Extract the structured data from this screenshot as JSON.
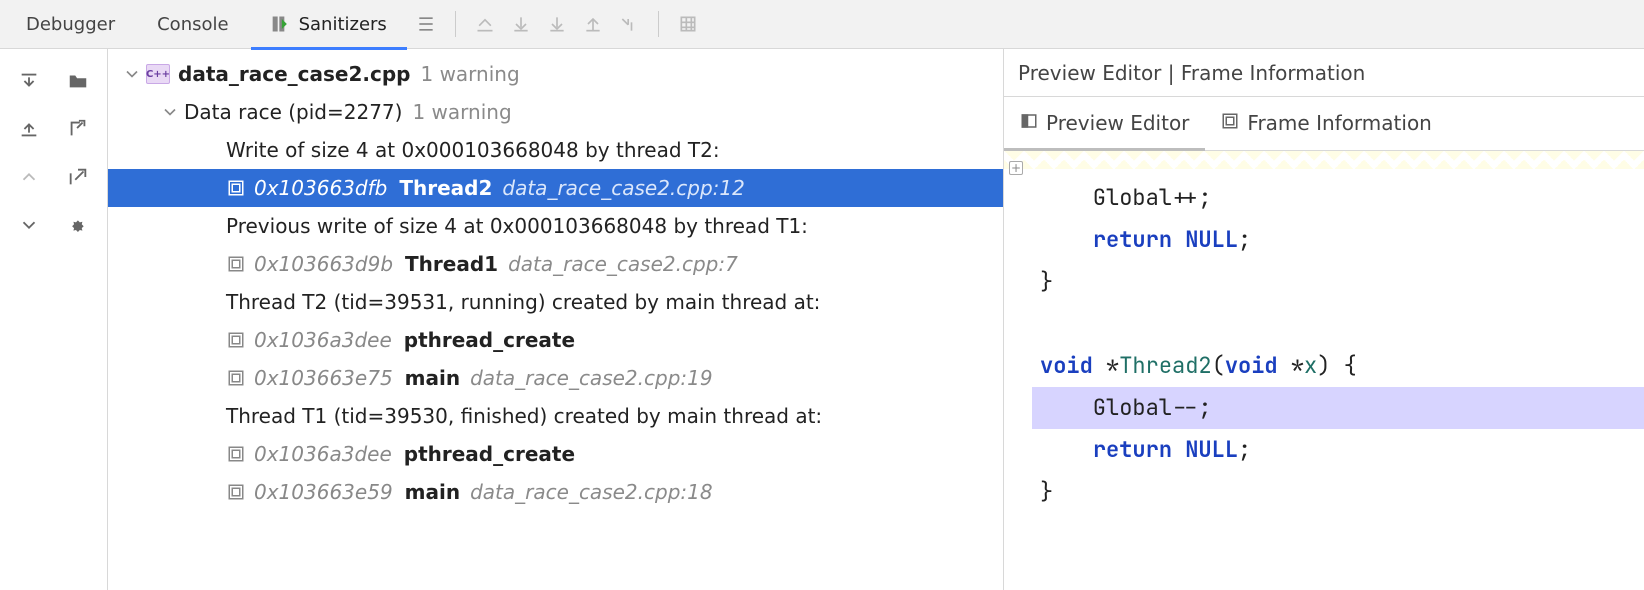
{
  "tabs": {
    "debugger": "Debugger",
    "console": "Console",
    "sanitizers": "Sanitizers"
  },
  "tree": {
    "file_icon_text": "C++",
    "file_name": "data_race_case2.cpp",
    "file_warning_suffix": "1 warning",
    "race_title": "Data race (pid=2277)",
    "race_warning_suffix": "1 warning",
    "rows": [
      {
        "kind": "header",
        "text": "Write of size 4 at 0x000103668048 by thread T2:"
      },
      {
        "kind": "frame",
        "addr": "0x103663dfb",
        "func": "Thread2",
        "loc": "data_race_case2.cpp:12",
        "selected": true
      },
      {
        "kind": "header",
        "text": "Previous write of size 4 at 0x000103668048 by thread T1:"
      },
      {
        "kind": "frame",
        "addr": "0x103663d9b",
        "func": "Thread1",
        "loc": "data_race_case2.cpp:7"
      },
      {
        "kind": "header",
        "text": "Thread T2 (tid=39531, running) created by main thread at:"
      },
      {
        "kind": "frame",
        "addr": "0x1036a3dee",
        "func": "pthread_create",
        "loc": ""
      },
      {
        "kind": "frame",
        "addr": "0x103663e75",
        "func": "main",
        "loc": "data_race_case2.cpp:19"
      },
      {
        "kind": "header",
        "text": "Thread T1 (tid=39530, finished) created by main thread at:"
      },
      {
        "kind": "frame",
        "addr": "0x1036a3dee",
        "func": "pthread_create",
        "loc": ""
      },
      {
        "kind": "frame",
        "addr": "0x103663e59",
        "func": "main",
        "loc": "data_race_case2.cpp:18"
      }
    ]
  },
  "preview": {
    "header": "Preview Editor | Frame Information",
    "tabs": {
      "preview": "Preview Editor",
      "frame": "Frame Information"
    },
    "code_lines": [
      {
        "html": "    Global++;"
      },
      {
        "html": "    <span class='kw'>return</span> <span class='lit'>NULL</span>;"
      },
      {
        "html": "}"
      },
      {
        "html": ""
      },
      {
        "html": "<span class='kw'>void</span> *<span class='name'>Thread2</span>(<span class='kw'>void</span> *<span class='name'>x</span>) {"
      },
      {
        "html": "    Global--;",
        "highlight": true
      },
      {
        "html": "    <span class='kw'>return</span> <span class='lit'>NULL</span>;"
      },
      {
        "html": "}"
      }
    ]
  }
}
